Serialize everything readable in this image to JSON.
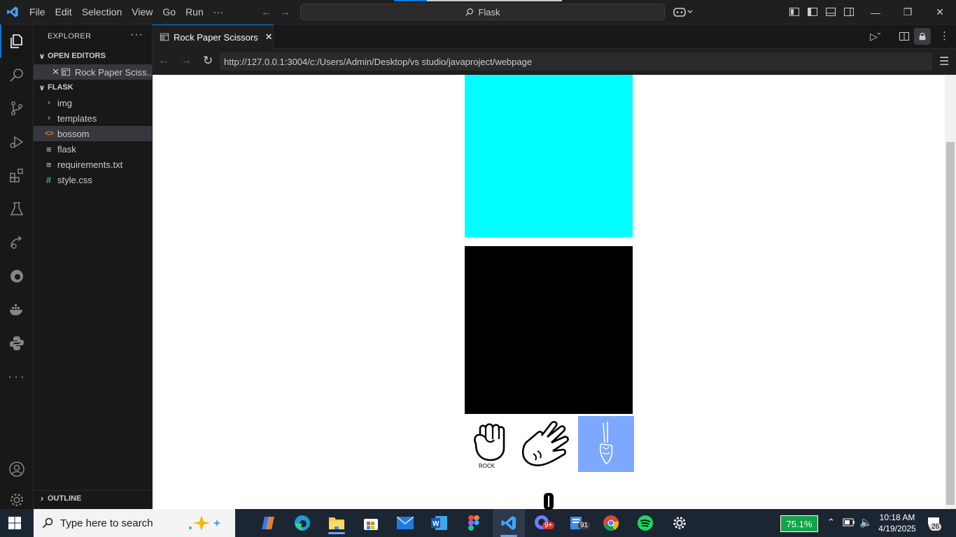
{
  "titlebar": {
    "menu": [
      "File",
      "Edit",
      "Selection",
      "View",
      "Go",
      "Run",
      "···"
    ],
    "search_text": "Flask"
  },
  "sidebar": {
    "title": "EXPLORER",
    "open_editors_label": "OPEN EDITORS",
    "open_editor_item": "Rock Paper Sciss...",
    "folder_label": "FLASK",
    "items": [
      {
        "label": "img",
        "kind": "folder"
      },
      {
        "label": "templates",
        "kind": "folder"
      },
      {
        "label": "bossom",
        "kind": "html",
        "selected": true
      },
      {
        "label": "flask",
        "kind": "text"
      },
      {
        "label": "requirements.txt",
        "kind": "text"
      },
      {
        "label": "style.css",
        "kind": "css"
      }
    ],
    "outline_label": "OUTLINE"
  },
  "editor": {
    "tab_label": "Rock Paper Scissors",
    "url": "http://127.0.0.1:3004/c:/Users/Admin/Desktop/vs studio/javaproject/webpage"
  },
  "webpage": {
    "rock_label": "ROCK",
    "colors": {
      "top_box": "#00ffff",
      "bottom_box": "#000000",
      "scissors_bg": "#7da8ff"
    }
  },
  "taskbar": {
    "search_placeholder": "Type here to search",
    "zoom": "75.1%",
    "time": "10:18 AM",
    "date": "4/19/2025",
    "badge_store": "91",
    "badge_notify": "26",
    "badge_app": "9+"
  },
  "colors": {
    "accent": "#0078d4",
    "editor_bg": "#1f1f1f",
    "sidebar_bg": "#181818"
  }
}
